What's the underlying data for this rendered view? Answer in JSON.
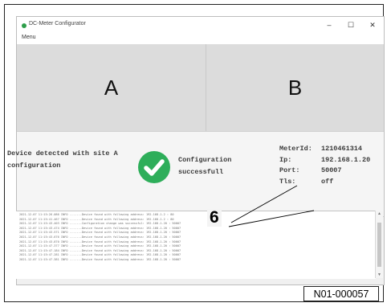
{
  "window": {
    "title": "DC-Meter Configurator",
    "minimize_glyph": "–",
    "maximize_glyph": "☐",
    "close_glyph": "✕"
  },
  "menu": {
    "label": "Menu"
  },
  "panels": {
    "a_label": "A",
    "b_label": "B"
  },
  "status": {
    "detected_line1": "Device detected with site A",
    "detected_line2": "configuration",
    "config_line1": "Configuration",
    "config_line2": "successfull",
    "success_color": "#2eae5a",
    "success_icon": "checkmark-icon"
  },
  "meter": {
    "meter_id_label": "MeterId:",
    "meter_id": "1210461314",
    "ip_label": "Ip:",
    "ip": "192.168.1.20",
    "port_label": "Port:",
    "port": "50007",
    "tls_label": "Tls:",
    "tls": "off"
  },
  "log": {
    "lines": [
      "2021-12-07 11:15:26.086  INFO  -------Device found with following address: 192.168.1.2 : 80",
      "2021-12-07 11:15:41.467  INFO  -------Device found with following address: 192.168.1.2 : 80",
      "2021-12-07 11:15:43.403  INFO  -------Configuration change was successful: 192.168.1.20 : 50007",
      "2021-12-07 11:15:43.474  INFO  -------Device found with following address: 192.168.1.20 : 50007",
      "2021-12-07 11:15:43.571  INFO  -------Device found with following address: 192.168.1.20 : 50007",
      "2021-12-07 11:15:43.676  INFO  -------Device found with following address: 192.168.1.20 : 50007",
      "2021-12-07 11:15:43.870  INFO  -------Device found with following address: 192.168.1.20 : 50007",
      "2021-12-07 11:15:47.377  INFO  -------Device found with following address: 192.168.1.20 : 50007",
      "2021-12-07 11:15:47.184  INFO  -------Device found with following address: 192.168.1.20 : 50007",
      "2021-12-07 11:15:47.281  INFO  -------Device found with following address: 192.168.1.20 : 50007",
      "2021-12-07 11:15:47.381  INFO  -------Device found with following address: 192.168.1.20 : 50007"
    ]
  },
  "callout": {
    "number": "6"
  },
  "reference": {
    "code": "N01-000057"
  }
}
